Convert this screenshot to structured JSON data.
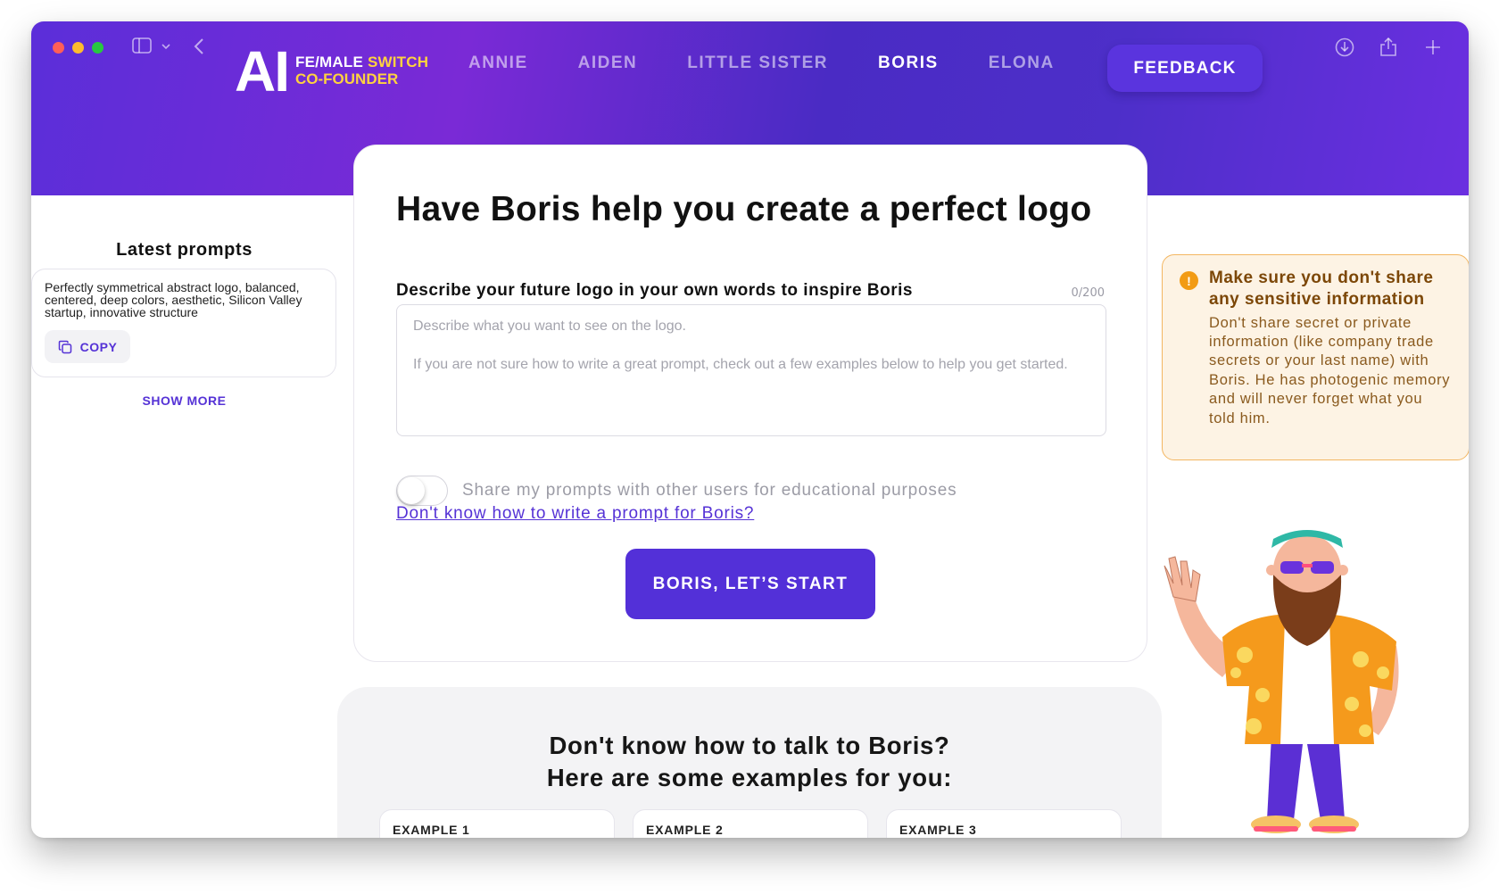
{
  "nav": {
    "logo_ai": "AI",
    "logo_line1_white": "FE/MALE ",
    "logo_line1_yellow": "SWITCH",
    "logo_line2": "CO-FOUNDER",
    "items": [
      {
        "label": "ANNIE",
        "active": false
      },
      {
        "label": "AIDEN",
        "active": false
      },
      {
        "label": "LITTLE SISTER",
        "active": false
      },
      {
        "label": "BORIS",
        "active": true
      },
      {
        "label": "ELONA",
        "active": false
      }
    ],
    "feedback_label": "FEEDBACK"
  },
  "main": {
    "title": "Have Boris help you create a perfect logo",
    "field_label": "Describe your future logo in your own words to inspire Boris",
    "counter": "0/200",
    "placeholder_line1": "Describe what you want to see on the logo.",
    "placeholder_line2": "If you are not sure how to write a great prompt, check out a few examples below to help you get started.",
    "share_toggle_label": "Share my prompts with other users for educational purposes",
    "help_link": "Don't know how to write a prompt for Boris?",
    "start_button": "BORIS, LET’S START"
  },
  "sidebar": {
    "title": "Latest prompts",
    "prompt_text": "Perfectly symmetrical abstract logo, balanced, centered, deep colors, aesthetic, Silicon Valley startup, innovative structure",
    "copy_label": "COPY",
    "show_more": "SHOW MORE"
  },
  "warning": {
    "title": "Make sure you don't share any sensitive information",
    "body": "Don't share secret or private information (like company trade secrets or your last name) with Boris. He has photogenic memory and will never forget what you told him.",
    "icon": "!"
  },
  "examples": {
    "title_line1": "Don't know how to talk to Boris?",
    "title_line2": "Here are some examples for you:",
    "cards": [
      "EXAMPLE 1",
      "EXAMPLE 2",
      "EXAMPLE 3"
    ]
  },
  "colors": {
    "accent": "#5330d8",
    "hero_gradient_start": "#5b2ed9",
    "hero_gradient_end": "#6b2fe0",
    "warning_bg": "#fdf3e4",
    "warning_border": "#f3b661"
  }
}
